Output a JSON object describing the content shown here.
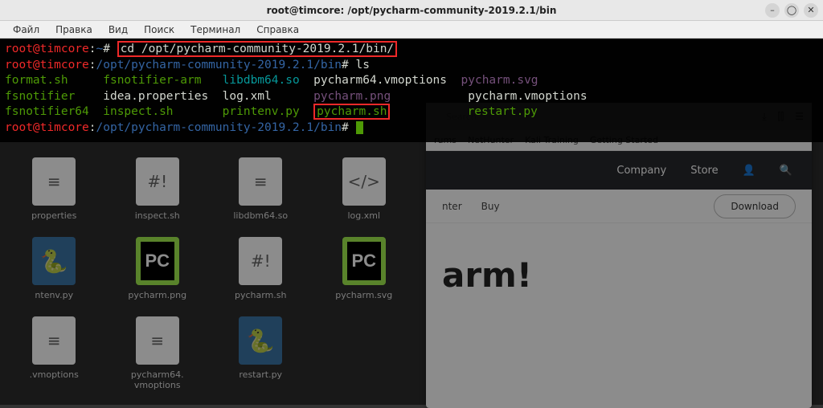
{
  "window": {
    "title": "root@timcore: /opt/pycharm-community-2019.2.1/bin"
  },
  "menubar": {
    "file": "Файл",
    "edit": "Правка",
    "view": "Вид",
    "search": "Поиск",
    "terminal": "Терминал",
    "help": "Справка"
  },
  "terminal": {
    "prompt_user": "root@timcore",
    "prompt_sep": ":",
    "prompt_home": "~",
    "prompt_hash": "# ",
    "cmd1": "cd /opt/pycharm-community-2019.2.1/bin/",
    "prompt_path": "/opt/pycharm-community-2019.2.1/bin",
    "cmd2": "ls",
    "ls": {
      "r1c1": "format.sh",
      "r1c2": "fsnotifier-arm",
      "r1c3": "libdbm64.so",
      "r1c4": "pycharm64.vmoptions",
      "r1c5": "pycharm.svg",
      "r2c1": "fsnotifier",
      "r2c2": "idea.properties",
      "r2c3": "log.xml",
      "r2c4": "pycharm.png",
      "r2c5": "pycharm.vmoptions",
      "r3c1": "fsnotifier64",
      "r3c2": "inspect.sh",
      "r3c3": "printenv.py",
      "r3c4": "pycharm.sh",
      "r3c5": "restart.py"
    }
  },
  "files": {
    "f1": "properties",
    "f2": "inspect.sh",
    "f3": "libdbm64.so",
    "f4": "log.xml",
    "f5": "ntenv.py",
    "f6": "pycharm.png",
    "f7": "pycharm.sh",
    "f8": "pycharm.svg",
    "f9": ".vmoptions",
    "f10": "pycharm64.\nvmoptions",
    "f11": "restart.py"
  },
  "browser": {
    "search_placeholder": "Search",
    "bm1": "rums",
    "bm2": "NetHunter",
    "bm3": "Kali Training",
    "bm4": "Getting Started",
    "nav1": "Company",
    "nav2": "Store",
    "sub1": "nter",
    "sub2": "Buy",
    "download": "Download",
    "headline": "arm!"
  },
  "icons": {
    "hash": "#!",
    "bars": "≡",
    "code": "</>",
    "pc": "PC",
    "py": "🐍",
    "person": "👤",
    "search": "🔍",
    "download": "⤓",
    "book": "⫿⫿",
    "menu": "☰"
  }
}
